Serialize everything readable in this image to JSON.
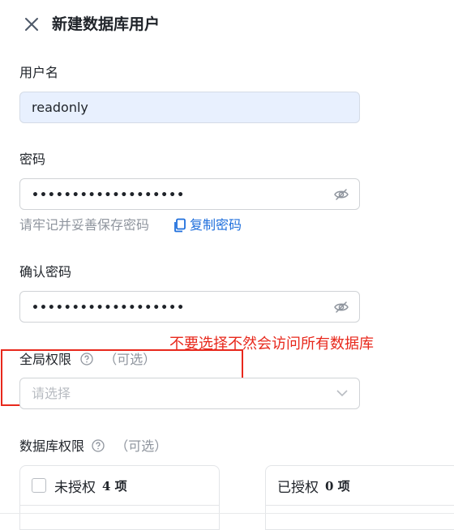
{
  "header": {
    "title": "新建数据库用户"
  },
  "username": {
    "label": "用户名",
    "value": "readonly"
  },
  "password": {
    "label": "密码",
    "masked_value": "•••••••••••••••••••",
    "hint": "请牢记并妥善保存密码",
    "copy_label": "复制密码"
  },
  "confirm_password": {
    "label": "确认密码",
    "masked_value": "•••••••••••••••••••"
  },
  "global_permissions": {
    "label": "全局权限",
    "optional": "（可选）",
    "placeholder": "请选择"
  },
  "annotation": {
    "text": "不要选择不然会访问所有数据库",
    "color": "#e8281c"
  },
  "db_permissions": {
    "label": "数据库权限",
    "optional": "（可选）",
    "unauthorized": {
      "label": "未授权",
      "count": "4 项"
    },
    "authorized": {
      "label": "已授权",
      "count": "0 项"
    }
  },
  "colors": {
    "accent": "#1f6fdc",
    "autofill_bg": "#e8f0fe",
    "annotation": "#e8281c"
  },
  "icons": [
    "close-icon",
    "eye-off-icon",
    "copy-icon",
    "help-icon",
    "chevron-down-icon"
  ]
}
